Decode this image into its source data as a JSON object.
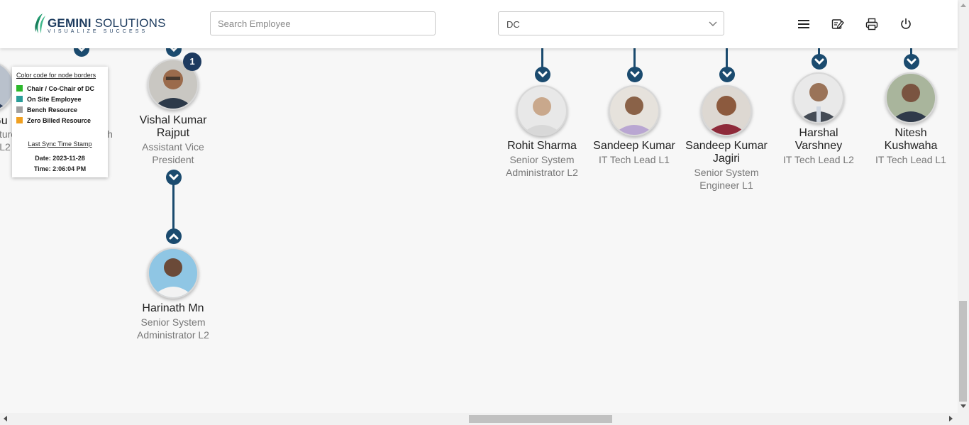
{
  "header": {
    "logo_word": "GEMINI",
    "logo_word2": "SOLUTIONS",
    "logo_tagline": "VISUALIZE SUCCESS",
    "search_placeholder": "Search Employee",
    "search_value": "",
    "department_selected": "DC",
    "icons": [
      "menu-icon",
      "edit-note-icon",
      "print-icon",
      "power-icon"
    ]
  },
  "legend": {
    "title": "Color code for node borders",
    "items": [
      {
        "label": "Chair / Co-Chair of DC",
        "color": "#2db82d"
      },
      {
        "label": "On Site Employee",
        "color": "#2a9d99"
      },
      {
        "label": "Bench Resource",
        "color": "#a0a0a0"
      },
      {
        "label": "Zero Billed Resource",
        "color": "#f0a020"
      }
    ],
    "sync_title": "Last Sync Time Stamp",
    "sync_date": "Date: 2023-11-28",
    "sync_time": "Time: 2:06:04 PM"
  },
  "partial_nodes": {
    "left_name": "Gu",
    "left_desig1": "ture",
    "left_desig2": "L2",
    "mid_desig": "Senior IT Tech"
  },
  "nodes": {
    "vishal": {
      "name1": "Vishal Kumar",
      "name2": "Rajput",
      "desig1": "Assistant Vice",
      "desig2": "President",
      "badge": "1"
    },
    "harinath": {
      "name": "Harinath Mn",
      "desig1": "Senior System",
      "desig2": "Administrator L2"
    },
    "rohit": {
      "name": "Rohit Sharma",
      "desig1": "Senior System",
      "desig2": "Administrator L2"
    },
    "sandeep": {
      "name": "Sandeep Kumar",
      "desig1": "IT Tech Lead L1"
    },
    "sandeep_j": {
      "name1": "Sandeep Kumar",
      "name2": "Jagiri",
      "desig1": "Senior System",
      "desig2": "Engineer L1"
    },
    "harshal": {
      "name1": "Harshal",
      "name2": "Varshney",
      "desig1": "IT Tech Lead L2"
    },
    "nitesh": {
      "name1": "Nitesh",
      "name2": "Kushwaha",
      "desig1": "IT Tech Lead L1"
    }
  },
  "colors": {
    "connector": "#1b4b6f",
    "badge": "#1d3a5f",
    "brand": "#1d3b5e"
  }
}
